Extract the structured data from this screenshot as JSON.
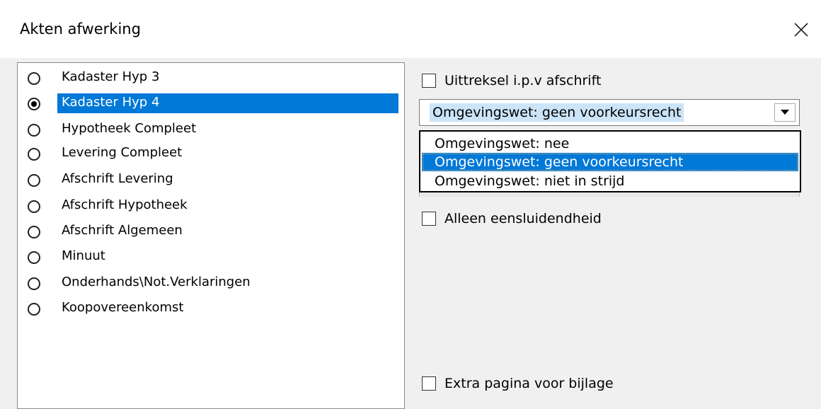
{
  "window": {
    "title": "Akten afwerking",
    "close_symbol": "✕"
  },
  "types": {
    "items": [
      {
        "label": "Kadaster Hyp 3",
        "checked": false,
        "selected": false
      },
      {
        "label": "Kadaster Hyp 4",
        "checked": true,
        "selected": true
      },
      {
        "label": "Hypotheek Compleet",
        "checked": false,
        "selected": false
      },
      {
        "label": "Levering Compleet",
        "checked": false,
        "selected": false
      },
      {
        "label": "Afschrift Levering",
        "checked": false,
        "selected": false
      },
      {
        "label": "Afschrift Hypotheek",
        "checked": false,
        "selected": false
      },
      {
        "label": "Afschrift Algemeen",
        "checked": false,
        "selected": false
      },
      {
        "label": "Minuut",
        "checked": false,
        "selected": false
      },
      {
        "label": "Onderhands\\Not.Verklaringen",
        "checked": false,
        "selected": false
      },
      {
        "label": "Koopovereenkomst",
        "checked": false,
        "selected": false
      }
    ]
  },
  "options": {
    "uittreksel": {
      "label": "Uittreksel i.p.v afschrift",
      "checked": false
    },
    "alleen": {
      "label": "Alleen eensluidendheid",
      "checked": false
    },
    "extra": {
      "label": "Extra pagina voor bijlage",
      "checked": false
    }
  },
  "combo": {
    "value": "Omgevingswet: geen voorkeursrecht",
    "options": [
      "Omgevingswet: nee",
      "Omgevingswet: geen voorkeursrecht",
      "Omgevingswet: niet in strijd"
    ],
    "highlighted_index": 1
  }
}
